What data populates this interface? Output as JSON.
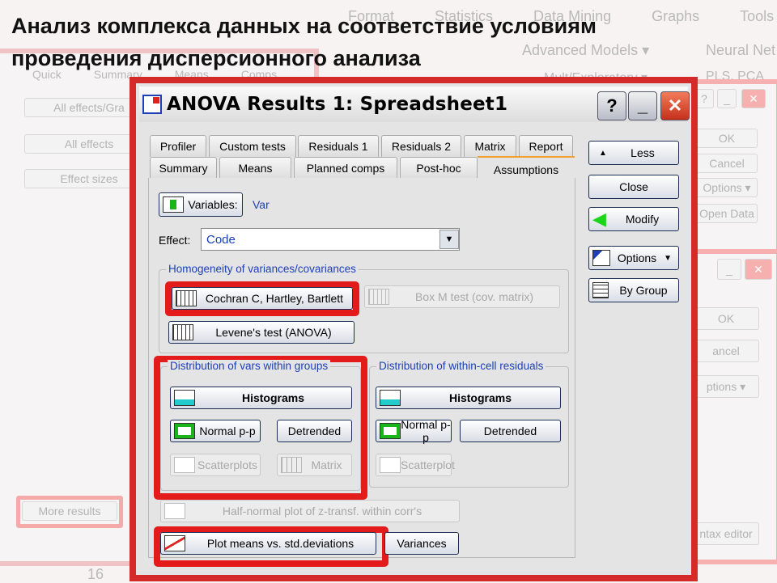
{
  "slide_title": {
    "line1": "Анализ комплекса данных на соответствие условиям",
    "line2": "проведения дисперсионного анализа"
  },
  "background": {
    "menu": [
      "Format",
      "Statistics",
      "Data Mining",
      "Graphs",
      "Tools"
    ],
    "ribbon": [
      "Advanced Models ▾",
      "Neural Net",
      "Mult/Exploratory ▾",
      "PLS, PCA"
    ],
    "left_tabs": [
      "Quick",
      "Summary",
      "Means",
      "Comps"
    ],
    "left_buttons": [
      "All effects/Gra",
      "All effects",
      "Effect sizes"
    ],
    "more_results": "More results",
    "row_number": "16",
    "right_win1": {
      "ok": "OK",
      "cancel": "Cancel",
      "options": "Options ▾",
      "open_data": "Open Data"
    },
    "right_win2": {
      "ok": "OK",
      "cancel": "ancel",
      "options": "ptions ▾",
      "syntax": "ntax editor"
    }
  },
  "dialog": {
    "title": "ANOVA Results 1: Spreadsheet1",
    "help": "?",
    "tabs_row1": [
      "Profiler",
      "Custom tests",
      "Residuals 1",
      "Residuals 2",
      "Matrix",
      "Report"
    ],
    "tabs_row2": [
      "Summary",
      "Means",
      "Planned comps",
      "Post-hoc",
      "Assumptions"
    ],
    "active_tab": "Assumptions",
    "variables_label": "Variables:",
    "variables_value": "Var",
    "effect_label": "Effect:",
    "effect_value": "Code",
    "homogeneity": {
      "label": "Homogeneity of variances/covariances",
      "cochran": "Cochran C, Hartley, Bartlett",
      "boxm": "Box M test (cov. matrix)",
      "levene": "Levene's test (ANOVA)"
    },
    "dist_vars": {
      "label": "Distribution of vars within groups",
      "histograms": "Histograms",
      "normal_pp": "Normal p-p",
      "detrended": "Detrended",
      "scatterplots": "Scatterplots",
      "matrix": "Matrix"
    },
    "dist_resid": {
      "label": "Distribution of within-cell residuals",
      "histograms": "Histograms",
      "normal_pp": "Normal p-p",
      "detrended": "Detrended",
      "scatterplot": "Scatterplot"
    },
    "half_normal": "Half-normal plot of z-transf. within corr's",
    "plot_means": "Plot means vs. std.deviations",
    "variances": "Variances",
    "side": {
      "less": "Less",
      "close": "Close",
      "modify": "Modify",
      "options": "Options",
      "by_group": "By Group"
    }
  },
  "colors": {
    "highlight": "#e31b1b",
    "group_label": "#1c3fb8",
    "dialog_border": "#d42a2a"
  }
}
